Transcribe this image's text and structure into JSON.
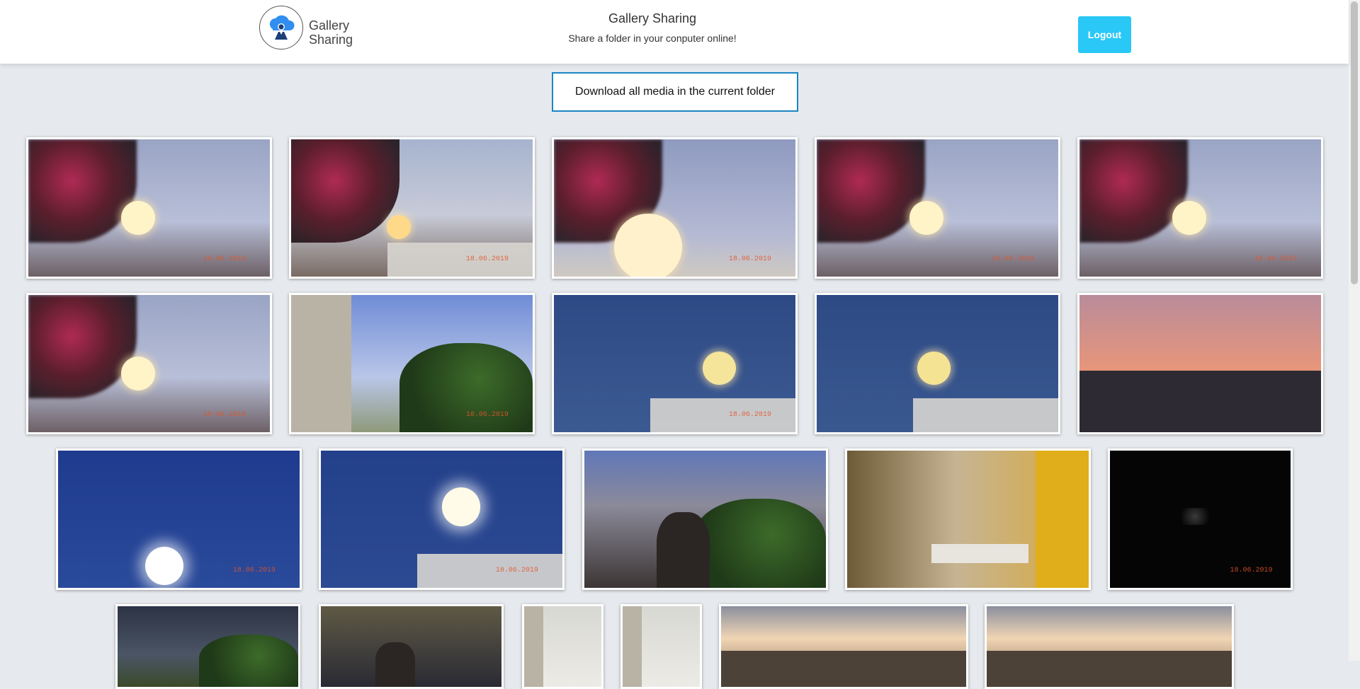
{
  "header": {
    "brand_line1": "Gallery",
    "brand_line2": "Sharing",
    "title": "Gallery Sharing",
    "subtitle": "Share a folder in your conputer online!",
    "logout_label": "Logout"
  },
  "download_label": "Download all media in the current folder",
  "colors": {
    "accent": "#29c8f6",
    "download_border": "#1b86c4",
    "background": "#e6e9ed"
  },
  "thumbnails": [
    {
      "scene": "flower-moon",
      "stamp": "18.06.2019"
    },
    {
      "scene": "flower-moon-buildings",
      "stamp": "18.06.2019"
    },
    {
      "scene": "flower-moon-closeup",
      "stamp": "18.06.2019"
    },
    {
      "scene": "flower-moon",
      "stamp": "18.06.2019"
    },
    {
      "scene": "flower-moon",
      "stamp": "18.06.2019"
    },
    {
      "scene": "flower-moon",
      "stamp": "18.06.2019"
    },
    {
      "scene": "balcony-tree",
      "stamp": "18.06.2019"
    },
    {
      "scene": "full-moon-night",
      "stamp": "18.06.2019"
    },
    {
      "scene": "full-moon-antennas",
      "stamp": ""
    },
    {
      "scene": "sunset-buildings",
      "stamp": ""
    },
    {
      "scene": "moon-low",
      "stamp": "18.06.2019"
    },
    {
      "scene": "moon-rooftop",
      "stamp": "18.06.2019"
    },
    {
      "scene": "person-balcony",
      "stamp": ""
    },
    {
      "scene": "kitchen",
      "stamp": ""
    },
    {
      "scene": "dark-night",
      "stamp": "18.06.2019"
    },
    {
      "scene": "tree-night",
      "stamp": ""
    },
    {
      "scene": "person-yellow",
      "stamp": ""
    },
    {
      "scene": "white-room",
      "stamp": ""
    },
    {
      "scene": "white-room",
      "stamp": ""
    },
    {
      "scene": "sunset-field",
      "stamp": ""
    },
    {
      "scene": "sunset-field",
      "stamp": ""
    }
  ]
}
